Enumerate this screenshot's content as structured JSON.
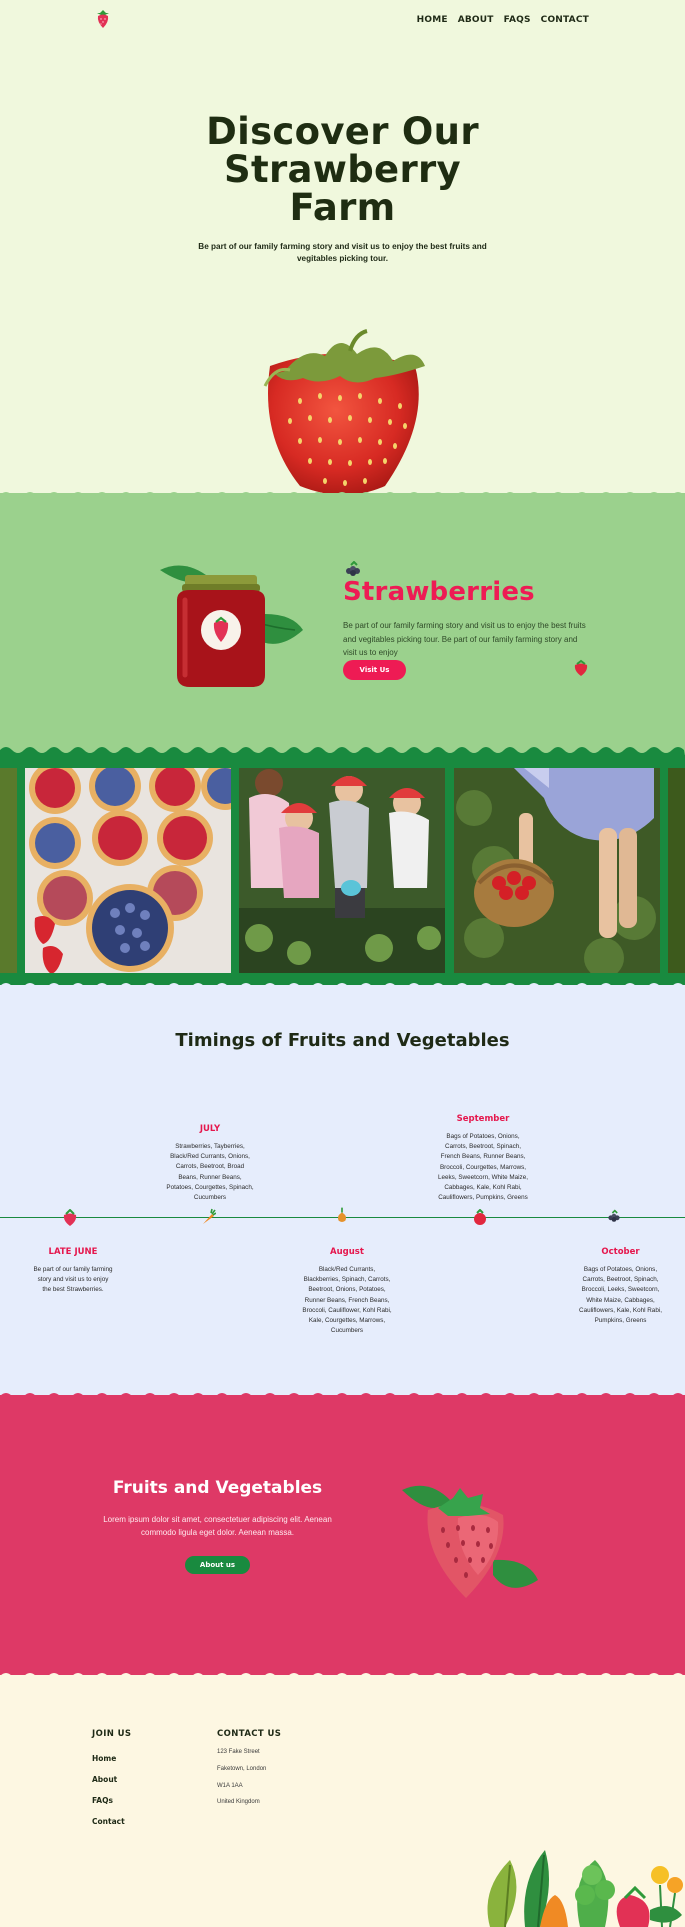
{
  "header": {
    "logo_icon": "strawberry-logo-icon",
    "nav": [
      "HOME",
      "ABOUT",
      "FAQS",
      "CONTACT"
    ]
  },
  "hero": {
    "title_line1": "Discover Our",
    "title_line2": "Strawberry",
    "title_line3": "Farm",
    "subtitle": "Be part of our family farming story and visit us to enjoy the best fruits and vegitables picking tour."
  },
  "strawberries": {
    "title": "Strawberries",
    "text": "Be part of our family farming story and visit us to enjoy the best fruits and vegitables picking tour. Be part of our family farming story and visit us to enjoy",
    "button": "Visit Us"
  },
  "timings": {
    "title": "Timings of Fruits and Vegetables",
    "months": [
      {
        "name": "LATE JUNE",
        "text": "Be part of our family farming story and visit us to enjoy the best Strawberries."
      },
      {
        "name": "JULY",
        "text": "Strawberries, Tayberries, Black/Red Currants, Onions, Carrots, Beetroot, Broad Beans, Runner Beans, Potatoes, Courgettes, Spinach, Cucumbers"
      },
      {
        "name": "August",
        "text": "Black/Red Currants, Blackberries, Spinach, Carrots, Beetroot, Onions, Potatoes, Runner Beans, French Beans, Broccoli, Cauliflower, Kohl Rabi, Kale, Courgettes, Marrows, Cucumbers"
      },
      {
        "name": "September",
        "text": "Bags of Potatoes, Onions, Carrots, Beetroot, Spinach, French Beans, Runner Beans, Broccoli, Courgettes, Marrows, Leeks, Sweetcorn, White Maize, Cabbages, Kale, Kohl Rabi, Cauliflowers, Pumpkins, Greens"
      },
      {
        "name": "October",
        "text": "Bags of Potatoes, Onions, Carrots, Beetroot, Spinach, Broccoli, Leeks, Sweetcorn, White Maize, Cabbages, Cauliflowers, Kale, Kohl Rabi, Pumpkins, Greens"
      }
    ]
  },
  "fruits_veg": {
    "title": "Fruits and Vegetables",
    "text": "Lorem ipsum dolor sit amet, consectetuer adipiscing elit. Aenean commodo ligula eget dolor. Aenean massa.",
    "button": "About us"
  },
  "footer": {
    "join_title": "JOIN US",
    "links": [
      "Home",
      "About",
      "FAQs",
      "Contact"
    ],
    "contact_title": "CONTACT US",
    "address": [
      "123 Fake Street",
      "Faketown, London",
      "W1A 1AA",
      "United Kingdom"
    ]
  },
  "colors": {
    "hero_bg": "#f0f8dd",
    "green_band": "#9bd18d",
    "dark_green": "#198a3f",
    "accent_red": "#ee1b54",
    "timings_bg": "#e6edfc",
    "red_band": "#de3966",
    "footer_bg": "#fdf7e2"
  }
}
